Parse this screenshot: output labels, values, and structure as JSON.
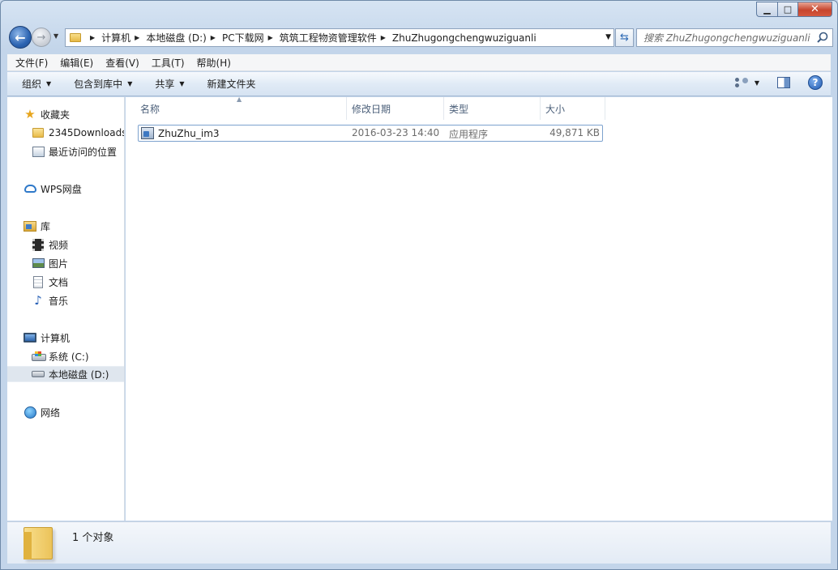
{
  "window": {
    "caption": {
      "minimize": "▁",
      "maximize": "□",
      "close": "✕"
    }
  },
  "address_bar": {
    "crumbs": [
      "计算机",
      "本地磁盘 (D:)",
      "PC下载网",
      "筑筑工程物资管理软件",
      "ZhuZhugongchengwuziguanli"
    ]
  },
  "search": {
    "placeholder": "搜索 ZhuZhugongchengwuziguanli"
  },
  "menubar": [
    "文件(F)",
    "编辑(E)",
    "查看(V)",
    "工具(T)",
    "帮助(H)"
  ],
  "commandbar": {
    "organize": "组织",
    "include_in_library": "包含到库中",
    "share": "共享",
    "new_folder": "新建文件夹"
  },
  "nav": {
    "favorites": "收藏夹",
    "downloads_2345": "2345Downloads",
    "recent_places": "最近访问的位置",
    "wps": "WPS网盘",
    "libraries": "库",
    "video": "视频",
    "pictures": "图片",
    "documents": "文档",
    "music": "音乐",
    "computer": "计算机",
    "drive_c": "系统 (C:)",
    "drive_d": "本地磁盘 (D:)",
    "network": "网络"
  },
  "columns": {
    "name": "名称",
    "modified": "修改日期",
    "type": "类型",
    "size": "大小"
  },
  "files": [
    {
      "name": "ZhuZhu_im3",
      "modified": "2016-03-23 14:40",
      "type": "应用程序",
      "size": "49,871 KB"
    }
  ],
  "status": {
    "count": "1 个对象"
  }
}
